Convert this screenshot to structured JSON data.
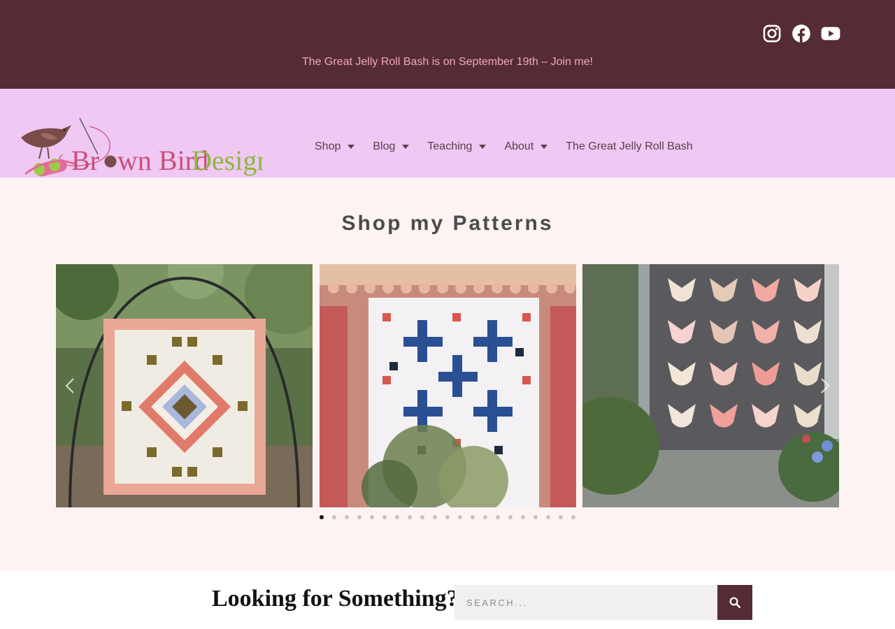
{
  "topbar": {
    "announcement": "The Great Jelly Roll Bash is on September 19th – Join me!",
    "social": [
      "instagram-icon",
      "facebook-icon",
      "youtube-icon"
    ],
    "bg_color": "#552b35",
    "text_color": "#f0a9bd"
  },
  "header": {
    "bg_color": "#efc8f3",
    "logo_text": "Brown Bird Designs",
    "nav": [
      {
        "label": "Shop",
        "has_dropdown": true
      },
      {
        "label": "Blog",
        "has_dropdown": true
      },
      {
        "label": "Teaching",
        "has_dropdown": true
      },
      {
        "label": "About",
        "has_dropdown": true
      },
      {
        "label": "The Great Jelly Roll Bash",
        "has_dropdown": false
      }
    ]
  },
  "main": {
    "title": "Shop my Patterns",
    "carousel": {
      "slide_count": 3,
      "dot_count": 21,
      "active_dot": 1
    }
  },
  "search": {
    "heading": "Looking for Something?",
    "placeholder": "SEARCH...",
    "button_icon": "search-icon",
    "accent_color": "#552b35"
  }
}
